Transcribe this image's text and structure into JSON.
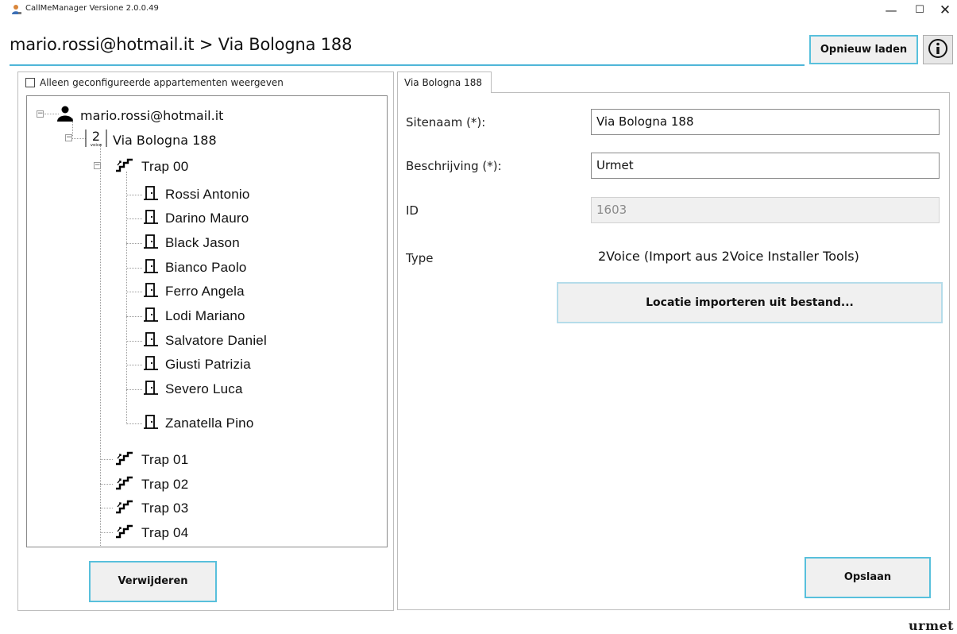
{
  "window": {
    "title": "CallMeManager Versione 2.0.0.49",
    "minimize_glyph": "—",
    "maximize_glyph": "☐",
    "close_glyph": "✕"
  },
  "header": {
    "breadcrumb": "mario.rossi@hotmail.it > Via Bologna 188",
    "reload_label": "Opnieuw laden"
  },
  "left": {
    "filter_checkbox_label": "Alleen geconfigureerde appartementen weergeven",
    "filter_checked": false,
    "tree": {
      "user": "mario.rossi@hotmail.it",
      "site": "Via Bologna 188",
      "stairs": [
        {
          "label": "Trap 00",
          "expanded": true,
          "apartments": [
            "Rossi Antonio",
            "Darino Mauro",
            "Black Jason",
            "Bianco Paolo",
            "Ferro Angela",
            "Lodi Mariano",
            "Salvatore Daniel",
            "Giusti Patrizia",
            "Severo Luca",
            "Zanatella Pino"
          ]
        },
        {
          "label": "Trap 01",
          "expanded": false
        },
        {
          "label": "Trap 02",
          "expanded": false
        },
        {
          "label": "Trap 03",
          "expanded": false
        },
        {
          "label": "Trap 04",
          "expanded": false
        }
      ]
    },
    "delete_label": "Verwijderen"
  },
  "right": {
    "tab_label": "Via Bologna 188",
    "fields": {
      "site_name_label": "Sitenaam (*):",
      "site_name_value": "Via Bologna 188",
      "description_label": "Beschrijving (*):",
      "description_value": "Urmet",
      "id_label": "ID",
      "id_value": "1603",
      "type_label": "Type",
      "type_value": "2Voice (Import aus 2Voice Installer Tools)"
    },
    "import_label": "Locatie importeren uit bestand...",
    "save_label": "Opslaan"
  },
  "footer": {
    "logo_text": "urmet"
  },
  "colors": {
    "accent": "#4fb6d8",
    "button_bg": "#f0f0f0",
    "border": "#8a8a8a"
  },
  "icons": {
    "app": "user-app-icon",
    "info": "info-icon",
    "user": "person-icon",
    "site": "2voice-icon",
    "stair": "stairs-icon",
    "apartment": "door-icon"
  }
}
